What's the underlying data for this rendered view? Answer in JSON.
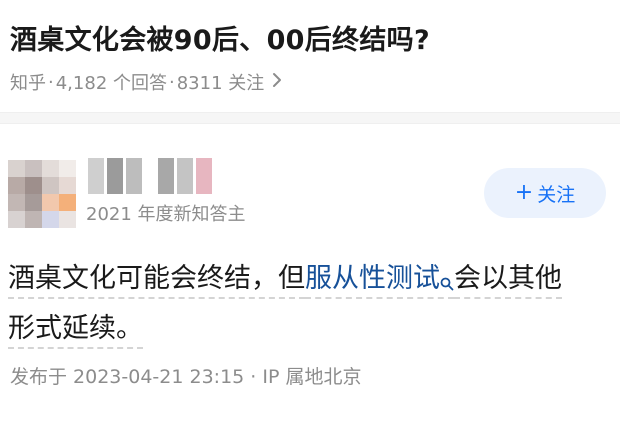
{
  "question": {
    "title": "酒桌文化会被90后、00后终结吗?",
    "source": "知乎",
    "answer_count": "4,182 个回答",
    "follower_count": "8311 关注",
    "separator": "·"
  },
  "author": {
    "badge": "2021 年度新知答主"
  },
  "follow_button": {
    "label": "关注"
  },
  "answer": {
    "part1": "酒桌文化可能会终结，但",
    "link_text": "服从性测试",
    "part2": "会以其他",
    "part3": "形式延续。"
  },
  "published": {
    "text": "发布于 2023-04-21 23:15 · IP 属地北京"
  },
  "colors": {
    "accent": "#1772f6",
    "link": "#175199",
    "meta": "#8c8c8c"
  },
  "icons": {
    "chevron": "chevron-right-icon",
    "search": "search-icon",
    "plus": "plus-icon"
  }
}
